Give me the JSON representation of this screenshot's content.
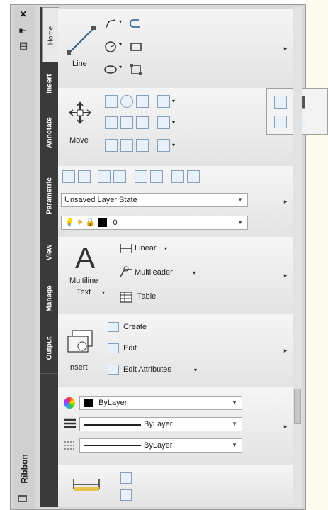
{
  "palette": {
    "title": "Ribbon",
    "close_glyph": "×",
    "autohide_glyph": "⇤",
    "properties_glyph": "▤"
  },
  "tabs": [
    {
      "label": "Home",
      "active": true
    },
    {
      "label": "Insert",
      "active": false
    },
    {
      "label": "Annotate",
      "active": false
    },
    {
      "label": "Parametric",
      "active": false
    },
    {
      "label": "View",
      "active": false
    },
    {
      "label": "Manage",
      "active": false
    },
    {
      "label": "Output",
      "active": false
    }
  ],
  "draw_panel": {
    "line_label": "Line"
  },
  "modify_panel": {
    "move_label": "Move"
  },
  "layers_panel": {
    "layer_state": "Unsaved Layer State",
    "current_layer": "0"
  },
  "annotation_panel": {
    "text_label_line1": "Multiline",
    "text_label_line2": "Text",
    "linear_label": "Linear",
    "multileader_label": "Multileader",
    "table_label": "Table"
  },
  "block_panel": {
    "insert_label": "Insert",
    "create_label": "Create",
    "edit_label": "Edit",
    "edit_attributes_label": "Edit Attributes"
  },
  "properties_panel": {
    "color_value": "ByLayer",
    "linetype_value": "ByLayer",
    "lineweight_value": "ByLayer"
  },
  "colors": {
    "tab_bg": "#3a3a3a",
    "desk_bg": "#fefcec",
    "panel_bg": "#ececec"
  }
}
